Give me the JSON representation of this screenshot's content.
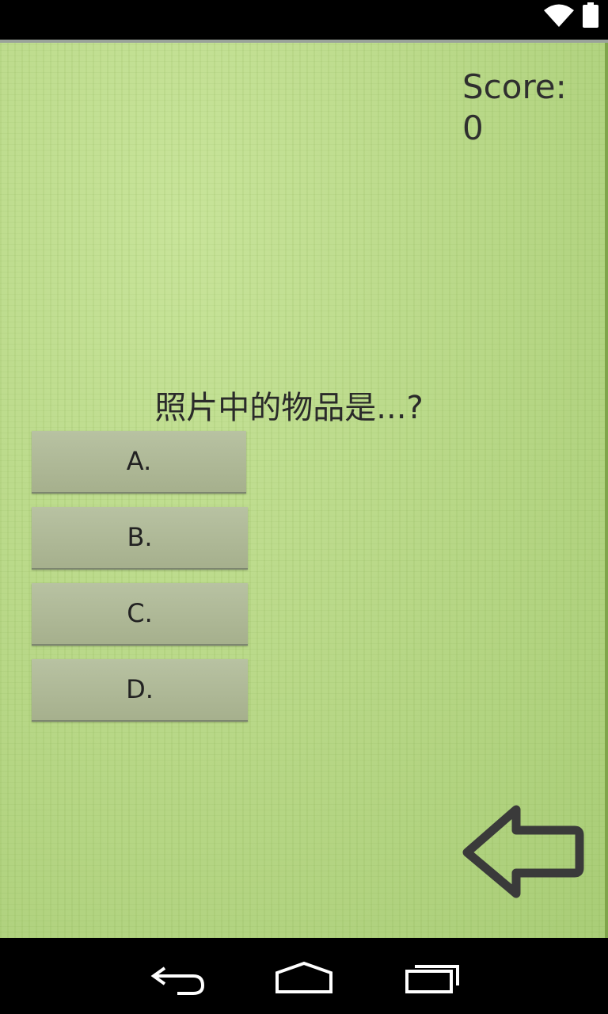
{
  "score": {
    "label": "Score:",
    "value": "0"
  },
  "question": "照片中的物品是...?",
  "options": [
    "A.",
    "B.",
    "C.",
    "D."
  ],
  "icons": {
    "status": [
      "wifi-icon",
      "battery-icon"
    ],
    "back": "back-arrow-icon",
    "nav": [
      "nav-back-icon",
      "nav-home-icon",
      "nav-recents-icon"
    ]
  },
  "colors": {
    "background": "#b7d786",
    "button": "#aeb897",
    "text": "#2f2f2f"
  }
}
